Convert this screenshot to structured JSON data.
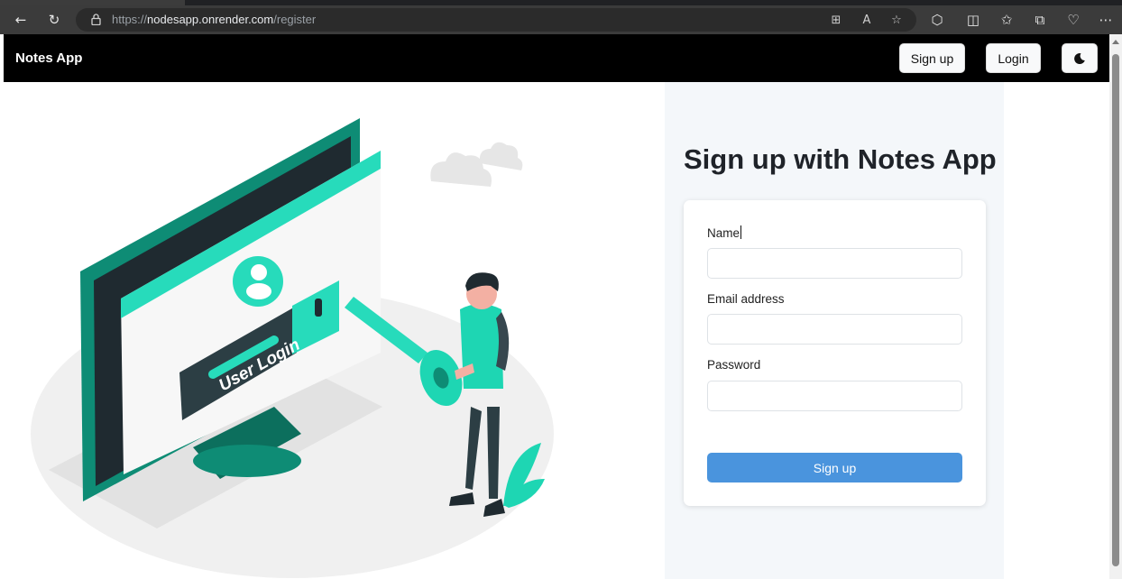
{
  "browser": {
    "url_scheme": "https://",
    "url_host": "nodesapp.onrender.com",
    "url_path": "/register"
  },
  "navbar": {
    "brand": "Notes App",
    "signup_label": "Sign up",
    "login_label": "Login",
    "theme_icon": "moon-icon"
  },
  "illustration": {
    "screen_text": "User Login"
  },
  "form": {
    "title": "Sign up with Notes App",
    "name_label": "Name",
    "name_value": "",
    "email_label": "Email address",
    "email_value": "",
    "password_label": "Password",
    "password_value": "",
    "submit_label": "Sign up"
  },
  "colors": {
    "navbar_bg": "#000000",
    "accent_teal": "#1ed6b3",
    "teal_dark": "#0c8c74",
    "submit_bg": "#4a94dd",
    "panel_bg": "#f4f7fa"
  }
}
